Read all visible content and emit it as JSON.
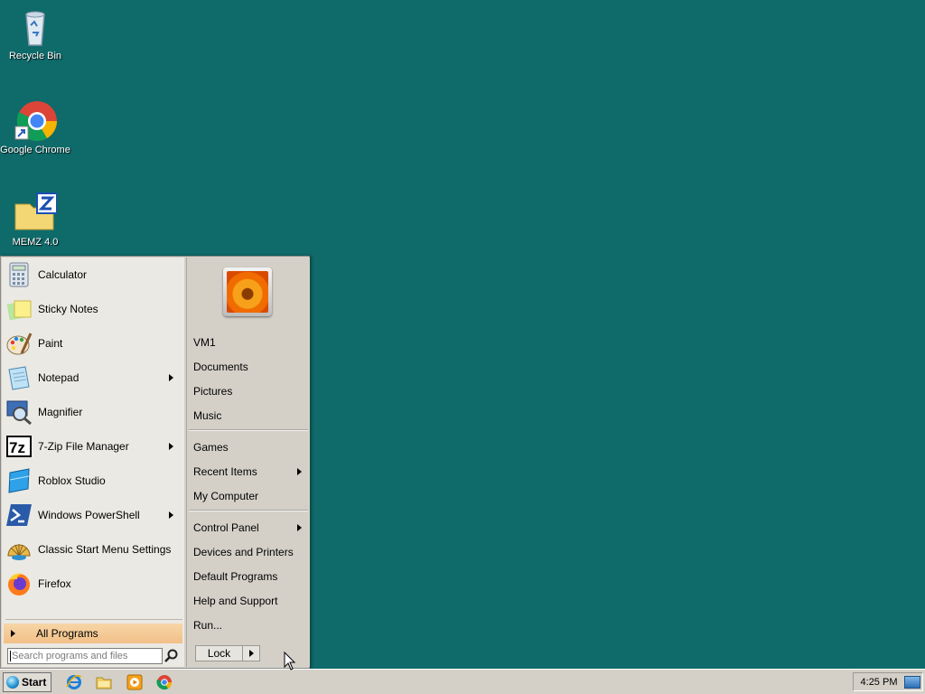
{
  "desktop": {
    "icons": [
      {
        "label": "Recycle Bin",
        "icon": "recycle-bin-icon"
      },
      {
        "label": "Google Chrome",
        "icon": "chrome-icon"
      },
      {
        "label": "MEMZ 4.0",
        "icon": "zip-folder-icon"
      }
    ],
    "background_color": "#0f6a6a"
  },
  "start_menu": {
    "programs": [
      {
        "label": "Calculator",
        "icon": "calculator-icon",
        "submenu": false
      },
      {
        "label": "Sticky Notes",
        "icon": "sticky-notes-icon",
        "submenu": false
      },
      {
        "label": "Paint",
        "icon": "paint-icon",
        "submenu": false
      },
      {
        "label": "Notepad",
        "icon": "notepad-icon",
        "submenu": true
      },
      {
        "label": "Magnifier",
        "icon": "magnifier-icon",
        "submenu": false
      },
      {
        "label": "7-Zip File Manager",
        "icon": "7zip-icon",
        "submenu": true
      },
      {
        "label": "Roblox Studio",
        "icon": "roblox-studio-icon",
        "submenu": false
      },
      {
        "label": "Windows PowerShell",
        "icon": "powershell-icon",
        "submenu": true
      },
      {
        "label": "Classic Start Menu Settings",
        "icon": "classic-shell-icon",
        "submenu": false
      },
      {
        "label": "Firefox",
        "icon": "firefox-icon",
        "submenu": false
      }
    ],
    "all_programs_label": "All Programs",
    "search_placeholder": "Search programs and files",
    "right_items": [
      {
        "label": "VM1",
        "submenu": false
      },
      {
        "label": "Documents",
        "submenu": false
      },
      {
        "label": "Pictures",
        "submenu": false
      },
      {
        "label": "Music",
        "submenu": false
      },
      {
        "label": "Games",
        "submenu": false
      },
      {
        "label": "Recent Items",
        "submenu": true
      },
      {
        "label": "My Computer",
        "submenu": false
      },
      {
        "label": "Control Panel",
        "submenu": true
      },
      {
        "label": "Devices and Printers",
        "submenu": false
      },
      {
        "label": "Default Programs",
        "submenu": false
      },
      {
        "label": "Help and Support",
        "submenu": false
      },
      {
        "label": "Run...",
        "submenu": false
      }
    ],
    "lock_label": "Lock"
  },
  "taskbar": {
    "start_label": "Start",
    "quick_launch": [
      "internet-explorer-icon",
      "file-explorer-icon",
      "media-player-icon",
      "chrome-icon"
    ],
    "clock": "4:25 PM"
  }
}
